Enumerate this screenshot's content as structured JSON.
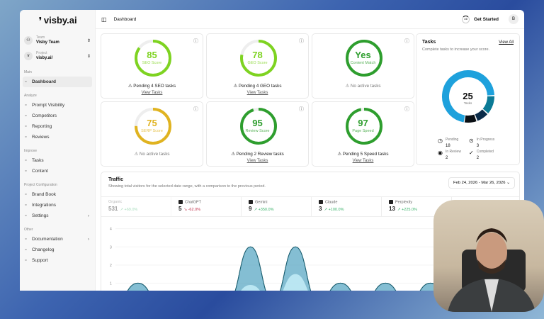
{
  "app": {
    "logo": "visby.ai"
  },
  "sidebar": {
    "team": {
      "label": "Team",
      "value": "Visby Team"
    },
    "project": {
      "label": "Project",
      "value": "visby.ai/"
    },
    "groups": [
      {
        "title": "Main",
        "items": [
          {
            "label": "Dashboard",
            "icon": "grid-icon"
          }
        ]
      },
      {
        "title": "Analyze",
        "items": [
          {
            "label": "Prompt Visibility",
            "icon": "eye-icon"
          },
          {
            "label": "Competitors",
            "icon": "trophy-icon"
          },
          {
            "label": "Reporting",
            "icon": "chart-icon"
          },
          {
            "label": "Reviews",
            "icon": "message-icon"
          }
        ]
      },
      {
        "title": "Improve",
        "items": [
          {
            "label": "Tasks",
            "icon": "list-icon"
          },
          {
            "label": "Content",
            "icon": "edit-icon"
          }
        ]
      },
      {
        "title": "Project Configuration",
        "items": [
          {
            "label": "Brand Book",
            "icon": "book-icon"
          },
          {
            "label": "Integrations",
            "icon": "plug-icon"
          },
          {
            "label": "Settings",
            "icon": "sliders-icon"
          }
        ]
      },
      {
        "title": "Other",
        "items": [
          {
            "label": "Documentation",
            "icon": "book-open-icon"
          },
          {
            "label": "Changelog",
            "icon": "megaphone-icon"
          },
          {
            "label": "Support",
            "icon": "lifebuoy-icon"
          }
        ]
      }
    ]
  },
  "header": {
    "breadcrumb": "Dashboard",
    "progress": "1/8",
    "get_started": "Get Started",
    "avatar": "B"
  },
  "scores": [
    {
      "value": "85",
      "label": "SEO Score",
      "pct": 85,
      "color": "#7ed321",
      "status": "Pending 4 SEO tasks",
      "link": "View Tasks"
    },
    {
      "value": "78",
      "label": "GEO Score",
      "pct": 78,
      "color": "#7ed321",
      "status": "Pending 4 GEO tasks",
      "link": "View Tasks"
    },
    {
      "value": "Yes",
      "label": "Content Match",
      "pct": 100,
      "color": "#2e9e2e",
      "status": "No active tasks",
      "link": ""
    },
    {
      "value": "75",
      "label": "SERP Score",
      "pct": 75,
      "color": "#e0b320",
      "status": "No active tasks",
      "link": ""
    },
    {
      "value": "95",
      "label": "Review Score",
      "pct": 95,
      "color": "#2e9e2e",
      "status": "Pending 2 Review tasks",
      "link": "View Tasks"
    },
    {
      "value": "97",
      "label": "Page Speed",
      "pct": 97,
      "color": "#2e9e2e",
      "status": "Pending 5 Speed tasks",
      "link": "View Tasks"
    }
  ],
  "tasks": {
    "title": "Tasks",
    "view_all": "View All",
    "subtitle": "Complete tasks to increase your score.",
    "total": "25",
    "total_label": "Tasks",
    "stats": [
      {
        "label": "Pending",
        "value": "18",
        "count": 18,
        "color": "#1ea1dc"
      },
      {
        "label": "In Progress",
        "value": "3",
        "count": 3,
        "color": "#0b7a96"
      },
      {
        "label": "In Review",
        "value": "2",
        "count": 2,
        "color": "#0b2c4a"
      },
      {
        "label": "Completed",
        "value": "2",
        "count": 2,
        "color": "#0a0f14"
      }
    ]
  },
  "traffic": {
    "title": "Traffic",
    "subtitle": "Showing total visitors for the selected date range, with a comparison to the previous period.",
    "date_range": "Feb 24, 2026 - Mar 26, 2026",
    "sources": [
      {
        "name": "Organic",
        "value": "531",
        "change": "+69.0%",
        "checked": false,
        "up": true
      },
      {
        "name": "ChatGPT",
        "value": "5",
        "change": "-62.0%",
        "checked": true,
        "up": false
      },
      {
        "name": "Gemini",
        "value": "9",
        "change": "+350.0%",
        "checked": true,
        "up": true
      },
      {
        "name": "Claude",
        "value": "3",
        "change": "+100.0%",
        "checked": true,
        "up": true
      },
      {
        "name": "Perplexity",
        "value": "13",
        "change": "+225.0%",
        "checked": true,
        "up": true
      }
    ]
  },
  "chart_data": {
    "type": "area",
    "yticks": [
      "1",
      "2",
      "3",
      "4"
    ],
    "ylim": [
      0,
      4.3
    ],
    "series": [
      {
        "values": [
          0,
          1,
          0,
          0,
          0,
          0,
          3,
          0,
          3,
          0,
          1,
          0,
          1,
          0,
          1,
          0,
          4,
          0
        ]
      },
      {
        "values": [
          0,
          1,
          0,
          0,
          0,
          0,
          3,
          0,
          3,
          0,
          1,
          0,
          1,
          0,
          1,
          0,
          3,
          0
        ]
      },
      {
        "values": [
          0,
          0.3,
          0,
          0,
          0,
          0,
          0.9,
          0,
          1.5,
          0,
          0.5,
          0,
          0.4,
          0,
          0.5,
          0,
          2.1,
          0
        ]
      }
    ]
  }
}
